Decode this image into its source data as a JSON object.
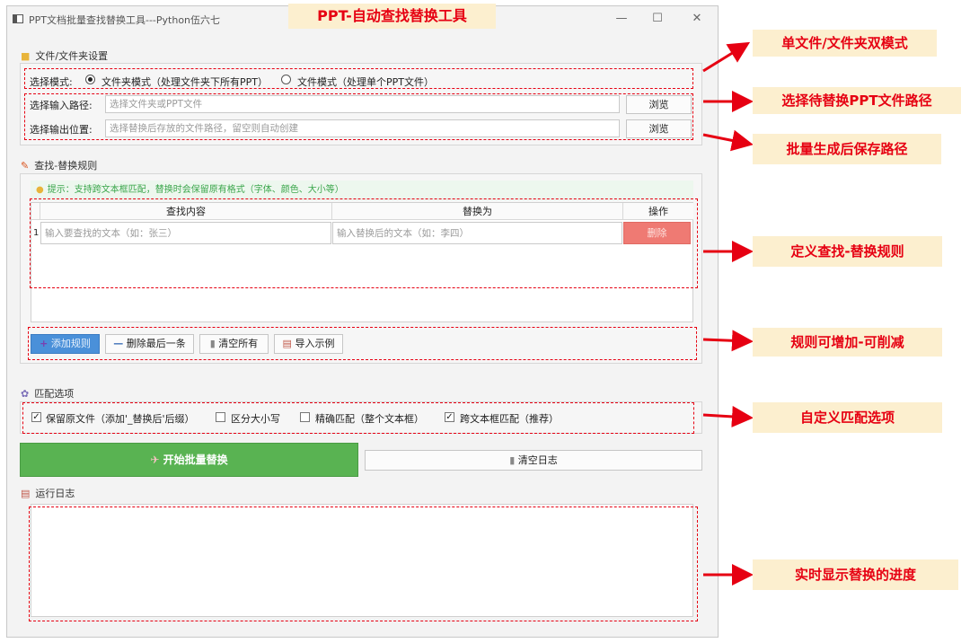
{
  "window": {
    "title": "PPT文档批量查找替换工具---Python伍六七",
    "minimize_glyph": "—",
    "maximize_glyph": "☐",
    "close_glyph": "✕"
  },
  "banner": {
    "text": "PPT-自动查找替换工具"
  },
  "file_section": {
    "title": "文件/文件夹设置",
    "icon": "folder-icon",
    "mode_label": "选择模式:",
    "mode_folder": "文件夹模式（处理文件夹下所有PPT）",
    "mode_file": "文件模式（处理单个PPT文件）",
    "selected_mode": "folder",
    "input_label": "选择输入路径:",
    "input_placeholder": "选择文件夹或PPT文件",
    "input_browse": "浏览",
    "output_label": "选择输出位置:",
    "output_placeholder": "选择替换后存放的文件路径，留空则自动创建",
    "output_browse": "浏览"
  },
  "rules_section": {
    "title": "查找-替换规则",
    "icon": "pencil-icon",
    "hint": "提示：支持跨文本框匹配，替换时会保留原有格式（字体、颜色、大小等）",
    "columns": [
      "查找内容",
      "替换为",
      "操作"
    ],
    "rows": [
      {
        "index": "1",
        "find_placeholder": "输入要查找的文本（如：张三）",
        "replace_placeholder": "输入替换后的文本（如：李四）",
        "delete_label": "删除"
      }
    ],
    "buttons": {
      "add": "添加规则",
      "remove_last": "删除最后一条",
      "clear_all": "清空所有",
      "import_example": "导入示例"
    }
  },
  "match_section": {
    "title": "匹配选项",
    "icon": "gear-icon",
    "options": [
      {
        "label": "保留原文件（添加'_替换后'后缀）",
        "checked": true
      },
      {
        "label": "区分大小写",
        "checked": false
      },
      {
        "label": "精确匹配（整个文本框）",
        "checked": false
      },
      {
        "label": "跨文本框匹配（推荐）",
        "checked": true
      }
    ]
  },
  "actions": {
    "start": "开始批量替换",
    "clear_log": "清空日志"
  },
  "log_section": {
    "title": "运行日志",
    "icon": "log-icon"
  },
  "callouts": {
    "mode": "单文件/文件夹双模式",
    "input_path": "选择待替换PPT文件路径",
    "output_path": "批量生成后保存路径",
    "rules": "定义查找-替换规则",
    "add_remove": "规则可增加-可削减",
    "match": "自定义匹配选项",
    "progress": "实时显示替换的进度"
  },
  "colors": {
    "accent_red": "#e60012",
    "callout_bg": "#fcefcf",
    "start_green": "#59b352",
    "delete_red": "#ef7a73",
    "add_blue": "#4a90d9"
  }
}
